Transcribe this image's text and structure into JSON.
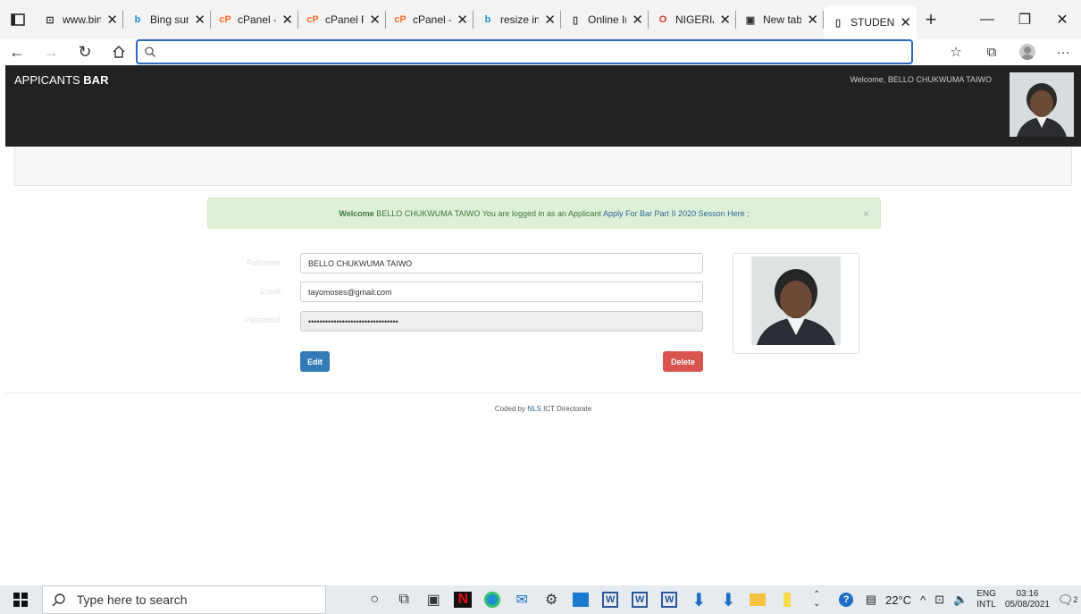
{
  "browser": {
    "tabs": [
      {
        "title": "www.bin",
        "icon": "lock-page-icon",
        "color": "#333333"
      },
      {
        "title": "Bing sur",
        "icon": "bing-icon",
        "color": "#1a8fd8"
      },
      {
        "title": "cPanel -",
        "icon": "cpanel-icon",
        "color": "#ff6c2c"
      },
      {
        "title": "cPanel F",
        "icon": "cpanel-icon",
        "color": "#ff6c2c"
      },
      {
        "title": "cPanel -",
        "icon": "cpanel-icon",
        "color": "#ff6c2c"
      },
      {
        "title": "resize in",
        "icon": "bing-icon",
        "color": "#1a8fd8"
      },
      {
        "title": "Online Ir",
        "icon": "page-icon",
        "color": "#333333"
      },
      {
        "title": "NIGERIA",
        "icon": "opera-icon",
        "color": "#e0312f"
      },
      {
        "title": "New tab",
        "icon": "newtab-icon",
        "color": "#333333"
      },
      {
        "title": "STUDEN",
        "icon": "page-icon",
        "color": "#333333",
        "active": true
      }
    ],
    "address": {
      "value": "",
      "placeholder": ""
    }
  },
  "header": {
    "brand_normal": "APPICANTS ",
    "brand_bold": "BAR",
    "welcome_text": "Welcome, BELLO CHUKWUMA TAIWO"
  },
  "alert": {
    "bold": "Welcome",
    "text": " BELLO CHUKWUMA TAIWO You are logged in as an Applicant ",
    "link": "Apply For Bar Part II 2020 Sesson Here",
    "suffix": " ;",
    "close": "×"
  },
  "form": {
    "fullname_label": "Fullname:",
    "fullname_value": "BELLO CHUKWUMA TAIWO",
    "email_label": "Email:",
    "email_value": "tayomoses@gmail.com",
    "password_label": "Password:",
    "password_value": "••••••••••••••••••••••••••••••••",
    "edit_label": "Edit",
    "delete_label": "Delete"
  },
  "footer": {
    "prefix": "Coded by ",
    "link": "NLS",
    "suffix": " ICT Directorate"
  },
  "taskbar": {
    "search_placeholder": "Type here to search",
    "weather": "22°C",
    "lang_top": "ENG",
    "lang_bottom": "INTL",
    "time": "03:16",
    "date": "05/08/2021",
    "notification_count": "2"
  }
}
